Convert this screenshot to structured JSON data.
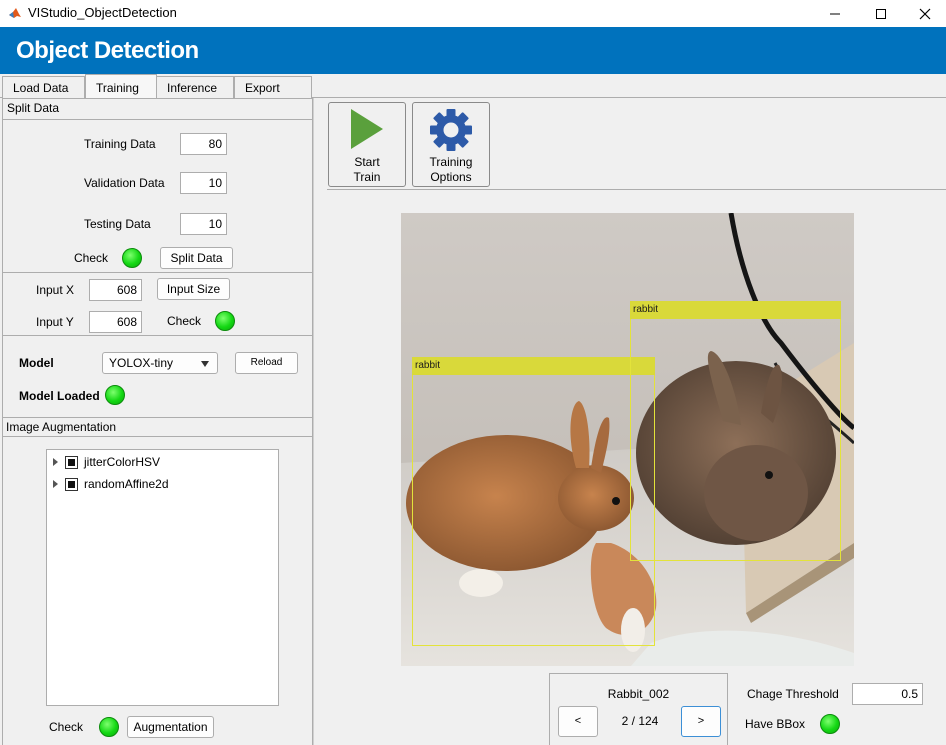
{
  "window": {
    "title": "VIStudio_ObjectDetection",
    "minimize": "—",
    "maximize": "☐",
    "close": "✕"
  },
  "header": {
    "title": "Object Detection"
  },
  "tabs": [
    {
      "label": "Load Data"
    },
    {
      "label": "Training"
    },
    {
      "label": "Inference"
    },
    {
      "label": "Export"
    }
  ],
  "split_data": {
    "title": "Split Data",
    "training_label": "Training Data",
    "training_value": "80",
    "validation_label": "Validation Data",
    "validation_value": "10",
    "testing_label": "Testing Data",
    "testing_value": "10",
    "check_label": "Check",
    "button": "Split Data"
  },
  "input_size": {
    "x_label": "Input X",
    "x_value": "608",
    "y_label": "Input Y",
    "y_value": "608",
    "button": "Input Size",
    "check_label": "Check"
  },
  "model": {
    "label": "Model",
    "selected": "YOLOX-tiny",
    "reload": "Reload",
    "loaded_label": "Model Loaded"
  },
  "augmentation": {
    "title": "Image Augmentation",
    "items": [
      {
        "label": "jitterColorHSV"
      },
      {
        "label": "randomAffine2d"
      }
    ],
    "check_label": "Check",
    "button": "Augmentation"
  },
  "toolbar": {
    "start_train_line1": "Start",
    "start_train_line2": "Train",
    "options_line1": "Training",
    "options_line2": "Options"
  },
  "detections": [
    {
      "label": "rabbit"
    },
    {
      "label": "rabbit"
    }
  ],
  "navigator": {
    "image_name": "Rabbit_002",
    "page": "2 / 124",
    "prev": "<",
    "next": ">"
  },
  "threshold": {
    "label": "Chage Threshold",
    "value": "0.5"
  },
  "bbox_status": {
    "label": "Have BBox"
  },
  "colors": {
    "banner": "#0072bd",
    "led": "#14d814",
    "bbox": "#e3e33a",
    "play": "#5aa03c",
    "gear": "#2d5aa8"
  }
}
